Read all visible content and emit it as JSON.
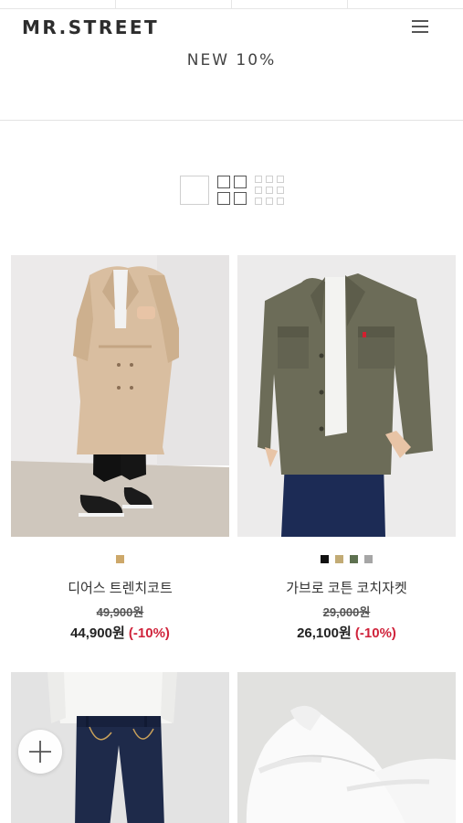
{
  "brand": {
    "logo": "MR.STREET"
  },
  "section": {
    "title": "NEW 10%"
  },
  "icons": {
    "menu": "hamburger-menu-icon",
    "view_large": "single-column-view-icon",
    "view_grid2": "two-column-grid-icon",
    "view_grid3": "three-column-grid-icon",
    "add": "plus-icon"
  },
  "products": [
    {
      "name": "디어스 트렌치코트",
      "original_price": "49,900원",
      "price": "44,900원",
      "discount": "(-10%)",
      "colors": [
        "#cda86a"
      ]
    },
    {
      "name": "가브로 코튼 코치자켓",
      "original_price": "29,000원",
      "price": "26,100원",
      "discount": "(-10%)",
      "colors": [
        "#111111",
        "#c2ab75",
        "#5e7150",
        "#a6a6a6"
      ]
    }
  ],
  "colors": {
    "accent_discount": "#d0243c"
  }
}
